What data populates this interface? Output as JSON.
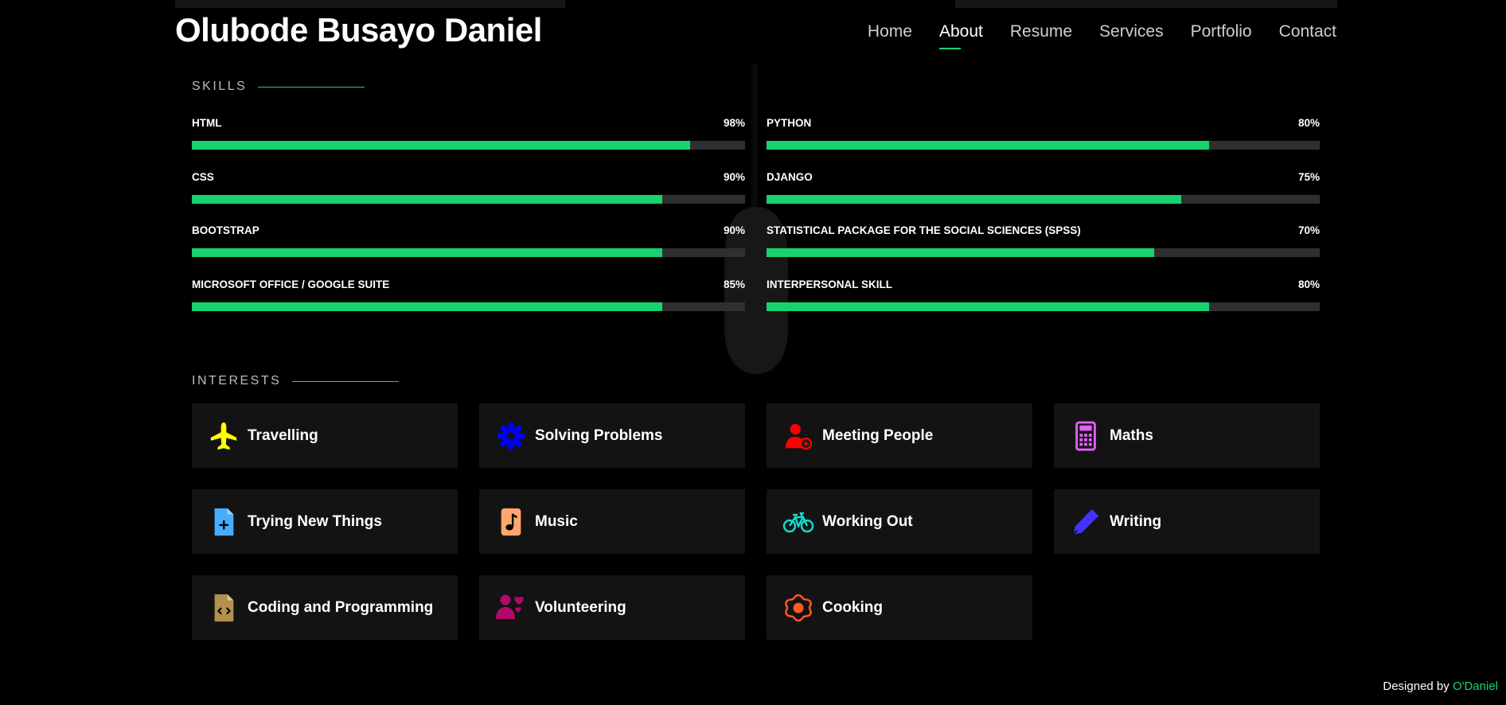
{
  "header": {
    "brand": "Olubode Busayo Daniel",
    "nav": [
      "Home",
      "About",
      "Resume",
      "Services",
      "Portfolio",
      "Contact"
    ],
    "active_index": 1
  },
  "skills": {
    "title": "SKILLS",
    "left": [
      {
        "name": "HTML",
        "percent": "98%",
        "fill": 0.9
      },
      {
        "name": "CSS",
        "percent": "90%",
        "fill": 0.85
      },
      {
        "name": "BOOTSTRAP",
        "percent": "90%",
        "fill": 0.85
      },
      {
        "name": "MICROSOFT OFFICE / GOOGLE SUITE",
        "percent": "85%",
        "fill": 0.85
      }
    ],
    "right": [
      {
        "name": "PYTHON",
        "percent": "80%",
        "fill": 0.8
      },
      {
        "name": "DJANGO",
        "percent": "75%",
        "fill": 0.75
      },
      {
        "name": "STATISTICAL PACKAGE FOR THE SOCIAL SCIENCES (SPSS)",
        "percent": "70%",
        "fill": 0.7
      },
      {
        "name": "INTERPERSONAL SKILL",
        "percent": "80%",
        "fill": 0.8
      }
    ],
    "fill_color": "#18d26e",
    "track_color": "#2f2f2f"
  },
  "interests": {
    "title": "INTERESTS",
    "items": [
      {
        "label": "Travelling",
        "icon": "plane-icon",
        "color": "#ffff00"
      },
      {
        "label": "Solving Problems",
        "icon": "gear-icon",
        "color": "#0000ff"
      },
      {
        "label": "Meeting People",
        "icon": "user-plus-icon",
        "color": "#ff0000"
      },
      {
        "label": "Maths",
        "icon": "calculator-icon",
        "color": "#e361ff"
      },
      {
        "label": "Trying New Things",
        "icon": "file-plus-icon",
        "color": "#47aeff"
      },
      {
        "label": "Music",
        "icon": "music-file-icon",
        "color": "#ffa76e"
      },
      {
        "label": "Working Out",
        "icon": "bicycle-icon",
        "color": "#11dbcf"
      },
      {
        "label": "Writing",
        "icon": "pen-icon",
        "color": "#4233ff"
      },
      {
        "label": "Coding and Programming",
        "icon": "code-file-icon",
        "color": "#b2904f"
      },
      {
        "label": "Volunteering",
        "icon": "volunteer-icon",
        "color": "#b20969"
      },
      {
        "label": "Cooking",
        "icon": "flower-icon",
        "color": "#ff5828"
      }
    ]
  },
  "footer": {
    "prefix": "Designed by ",
    "author": "O'Daniel"
  }
}
